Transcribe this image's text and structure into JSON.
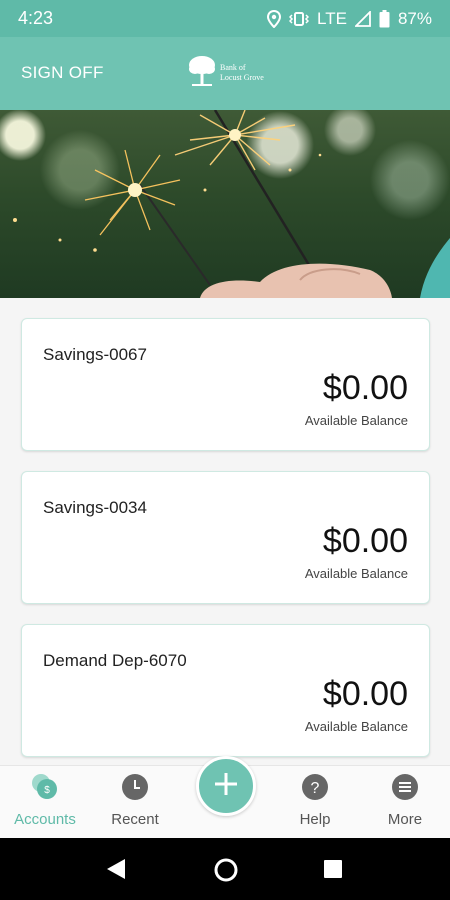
{
  "status_bar": {
    "time": "4:23",
    "network": "LTE",
    "battery": "87%",
    "icons": [
      "location-icon",
      "vibrate-icon",
      "signal-icon",
      "battery-icon"
    ]
  },
  "app_bar": {
    "sign_off_label": "SIGN OFF",
    "logo_line1": "Bank of",
    "logo_line2": "Locust Grove",
    "colors": {
      "bar": "#6fc3b2",
      "status": "#5fbaa8"
    }
  },
  "accounts": [
    {
      "name": "Savings-0067",
      "amount": "$0.00",
      "label": "Available Balance"
    },
    {
      "name": "Savings-0034",
      "amount": "$0.00",
      "label": "Available Balance"
    },
    {
      "name": "Demand Dep-6070",
      "amount": "$0.00",
      "label": "Available Balance"
    }
  ],
  "bottom_nav": {
    "items": [
      {
        "label": "Accounts",
        "icon": "accounts-icon",
        "active": true,
        "badge": "$"
      },
      {
        "label": "Recent",
        "icon": "clock-icon",
        "active": false
      },
      {
        "label": "Help",
        "icon": "help-icon",
        "active": false,
        "glyph": "?"
      },
      {
        "label": "More",
        "icon": "menu-icon",
        "active": false
      }
    ],
    "fab_icon": "plus-icon",
    "accent": "#5fbaa8"
  },
  "system_nav": [
    "back-icon",
    "home-icon",
    "recents-icon"
  ]
}
